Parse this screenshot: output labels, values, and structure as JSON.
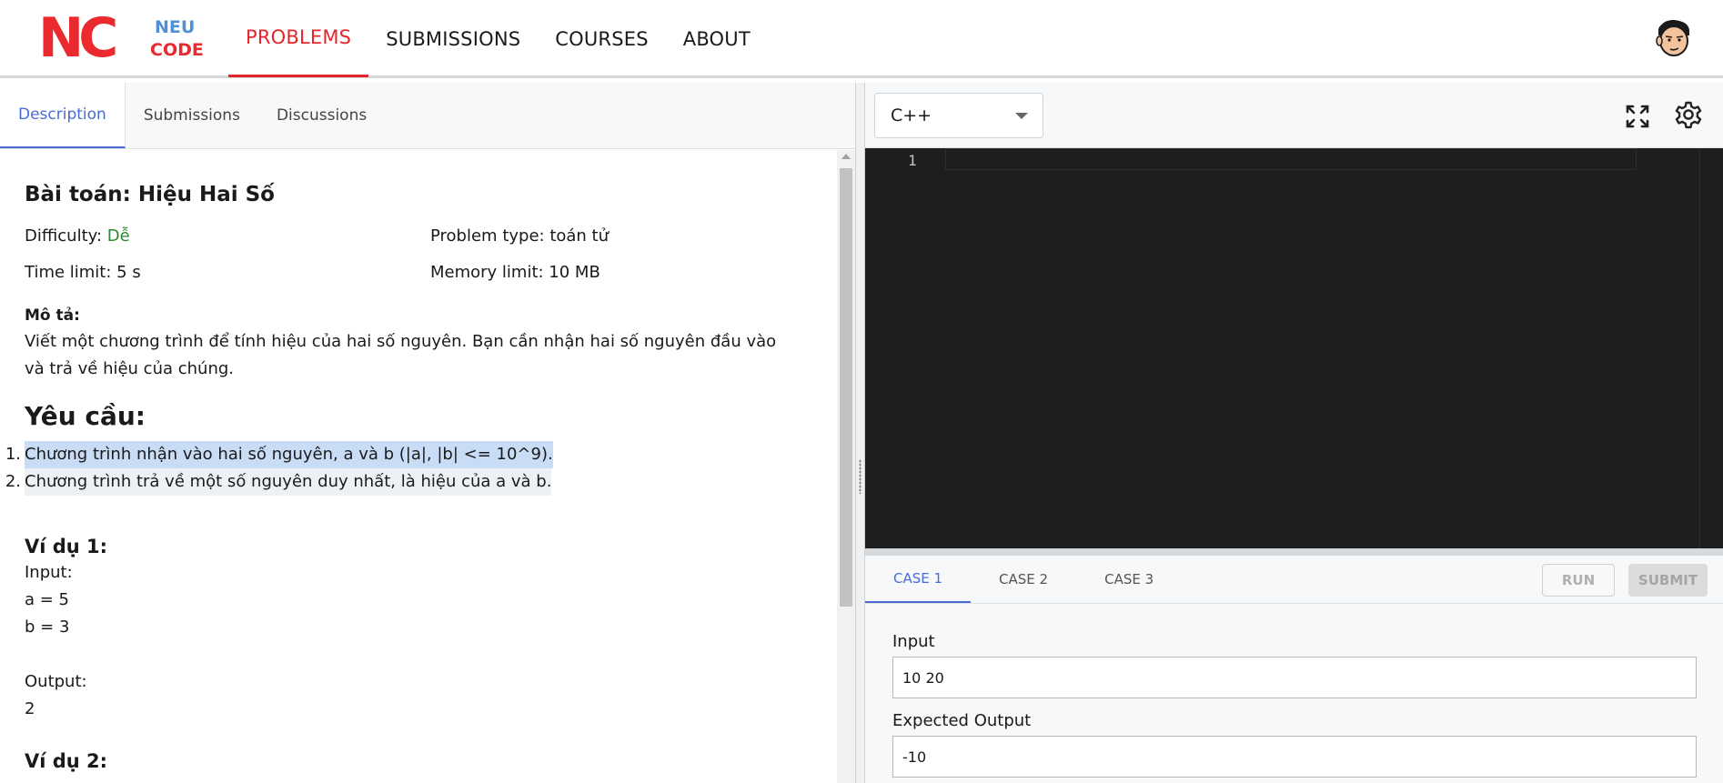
{
  "brand": {
    "initials": "NC",
    "word1": "NEU",
    "word2": "CODE",
    "colors": {
      "red": "#ea2a2e",
      "blue": "#4f8fd6"
    }
  },
  "nav": {
    "items": [
      {
        "label": "PROBLEMS",
        "active": true
      },
      {
        "label": "SUBMISSIONS",
        "active": false
      },
      {
        "label": "COURSES",
        "active": false
      },
      {
        "label": "ABOUT",
        "active": false
      }
    ]
  },
  "left_tabs": [
    "Description",
    "Submissions",
    "Discussions"
  ],
  "problem": {
    "title": "Bài toán: Hiệu Hai Số",
    "difficulty_label": "Difficulty:",
    "difficulty_value": "Dễ",
    "problem_type_label": "Problem type:",
    "problem_type_value": "toán tử",
    "time_limit": "Time limit: 5 s",
    "memory_limit": "Memory limit: 10 MB",
    "desc_heading": "Mô tả:",
    "desc_line1": "Viết một chương trình để tính hiệu của hai số nguyên. Bạn cần nhận hai số nguyên đầu vào",
    "desc_line2": "và trả về hiệu của chúng.",
    "req_heading": "Yêu cầu:",
    "requirements": [
      {
        "num": "1.",
        "text": "Chương trình nhận vào hai số nguyên, a và b (|a|, |b| <= 10^9)."
      },
      {
        "num": "2.",
        "text": "Chương trình trả về một số nguyên duy nhất, là hiệu của a và b."
      }
    ],
    "example1": {
      "heading": "Ví dụ 1:",
      "input_label": "Input:",
      "a": "a = 5",
      "b": "b = 3",
      "output_label": "Output:",
      "output": "2"
    },
    "example2_heading": "Ví dụ 2:"
  },
  "editor": {
    "language": "C++",
    "line_numbers": [
      "1"
    ],
    "icons": [
      "fullscreen-icon",
      "gear-icon"
    ]
  },
  "testcases": {
    "tabs": [
      "CASE 1",
      "CASE 2",
      "CASE 3"
    ],
    "run_label": "RUN",
    "submit_label": "SUBMIT",
    "input_label": "Input",
    "input_value": "10 20",
    "expected_label": "Expected Output",
    "expected_value": "-10"
  },
  "colors": {
    "accent_red": "#e3262c",
    "accent_blue": "#4a6bd4",
    "easy_green": "#2d8a2d",
    "editor_bg": "#1e1e1e",
    "highlight": "#c9dcf5"
  }
}
